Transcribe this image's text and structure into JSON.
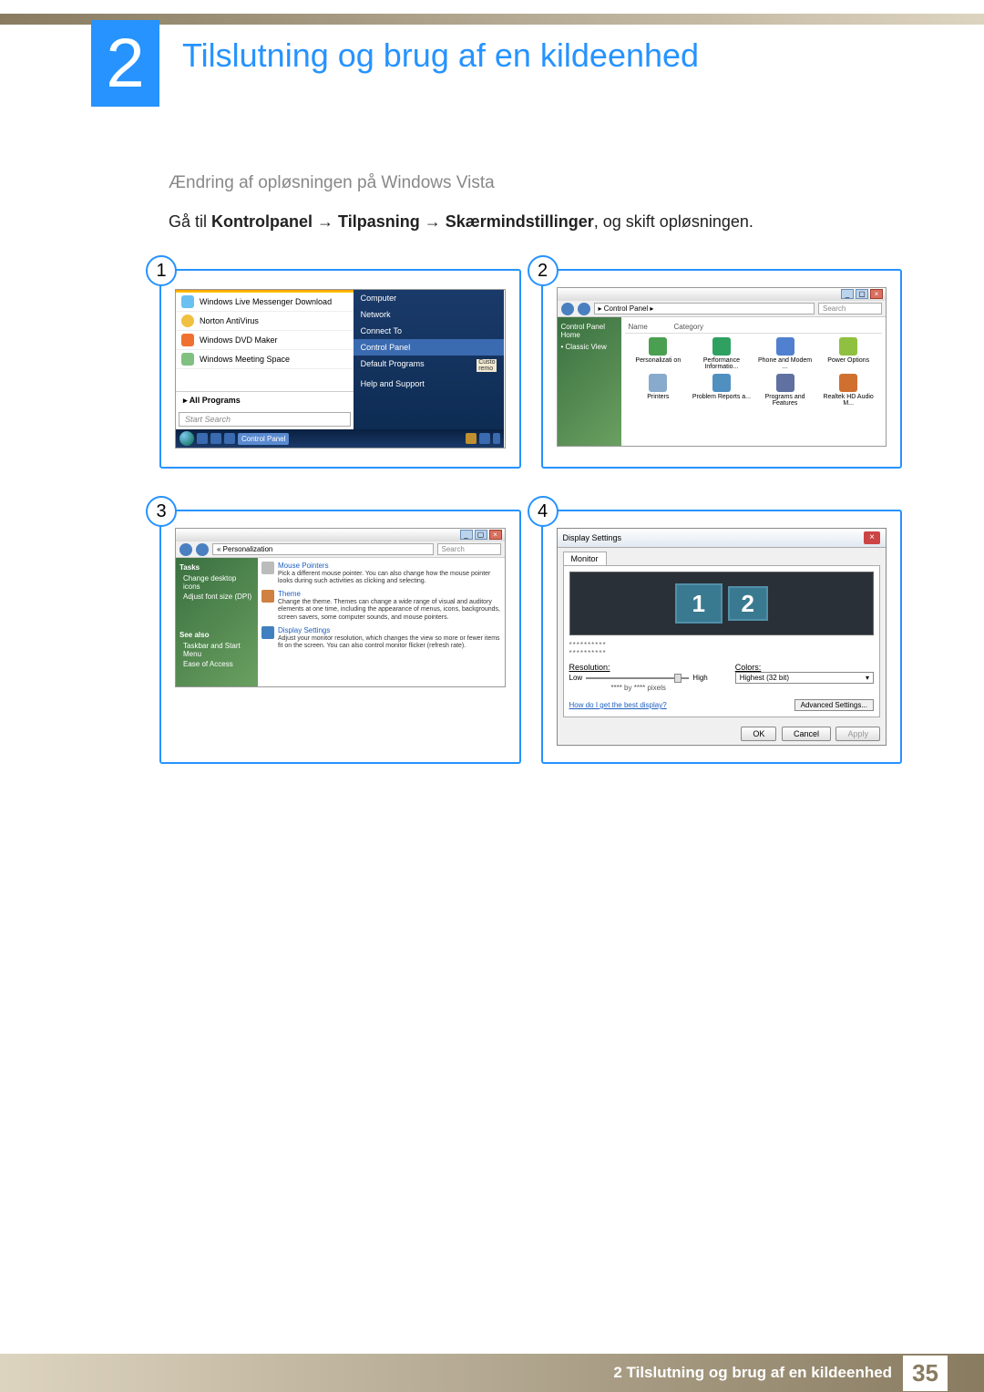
{
  "chapter": {
    "number": "2",
    "title": "Tilslutning og brug af en kildeenhed"
  },
  "section": {
    "subheading": "Ændring af opløsningen på Windows Vista"
  },
  "instruction": {
    "prefix": "Gå til ",
    "path1": "Kontrolpanel",
    "arrow": " → ",
    "path2": "Tilpasning",
    "path3": "Skærmindstillinger",
    "suffix": ", og skift opløsningen."
  },
  "steps": {
    "s1": "1",
    "s2": "2",
    "s3": "3",
    "s4": "4"
  },
  "fig1": {
    "items": [
      "Windows Live Messenger Download",
      "Norton AntiVirus",
      "Windows DVD Maker",
      "Windows Meeting Space"
    ],
    "allPrograms": "All Programs",
    "searchPlaceholder": "Start Search",
    "right": [
      "Computer",
      "Network",
      "Connect To",
      "Control Panel",
      "Default Programs",
      "Help and Support"
    ],
    "rightHighlight": "Control Panel",
    "taskbar_label": "Control Panel",
    "custo": "Custo",
    "remo": "remo"
  },
  "fig2": {
    "addressbar": "▸ Control Panel ▸",
    "searchPlaceholder": "Search",
    "side": {
      "home": "Control Panel Home",
      "classic": "Classic View"
    },
    "headers": {
      "name": "Name",
      "category": "Category"
    },
    "icons": [
      {
        "label": "Personalizati on",
        "c": "#4aa050"
      },
      {
        "label": "Performance Informatio...",
        "c": "#30a060"
      },
      {
        "label": "Phone and Modem ...",
        "c": "#5080d0"
      },
      {
        "label": "Power Options",
        "c": "#90c040"
      },
      {
        "label": "Printers",
        "c": "#88aacc"
      },
      {
        "label": "Problem Reports a...",
        "c": "#5090c0"
      },
      {
        "label": "Programs and Features",
        "c": "#6070a0"
      },
      {
        "label": "Realtek HD Audio M...",
        "c": "#d07030"
      }
    ]
  },
  "fig3": {
    "addressbar": "« Personalization",
    "searchPlaceholder": "Search",
    "side": {
      "tasks": "Tasks",
      "items": [
        "Change desktop icons",
        "Adjust font size (DPI)"
      ],
      "seealso": "See also",
      "below": [
        "Taskbar and Start Menu",
        "Ease of Access"
      ]
    },
    "options": [
      {
        "title": "Mouse Pointers",
        "desc": "Pick a different mouse pointer. You can also change how the mouse pointer looks during such activities as clicking and selecting.",
        "c": "#bbb"
      },
      {
        "title": "Theme",
        "desc": "Change the theme. Themes can change a wide range of visual and auditory elements at one time, including the appearance of menus, icons, backgrounds, screen savers, some computer sounds, and mouse pointers.",
        "c": "#d08040"
      },
      {
        "title": "Display Settings",
        "desc": "Adjust your monitor resolution, which changes the view so more or fewer items fit on the screen. You can also control monitor flicker (refresh rate).",
        "c": "#4080c0"
      }
    ]
  },
  "fig4": {
    "title": "Display Settings",
    "tab": "Monitor",
    "mon1": "1",
    "mon2": "2",
    "dots1": "**********",
    "dots2": "**********",
    "resLabel": "Resolution:",
    "low": "Low",
    "high": "High",
    "pixels": "**** by **** pixels",
    "colorsLabel": "Colors:",
    "colorsValue": "Highest (32 bit)",
    "bestLink": "How do I get the best display?",
    "advanced": "Advanced Settings...",
    "ok": "OK",
    "cancel": "Cancel",
    "apply": "Apply"
  },
  "footer": {
    "text": "2 Tilslutning og brug af en kildeenhed",
    "page": "35"
  }
}
